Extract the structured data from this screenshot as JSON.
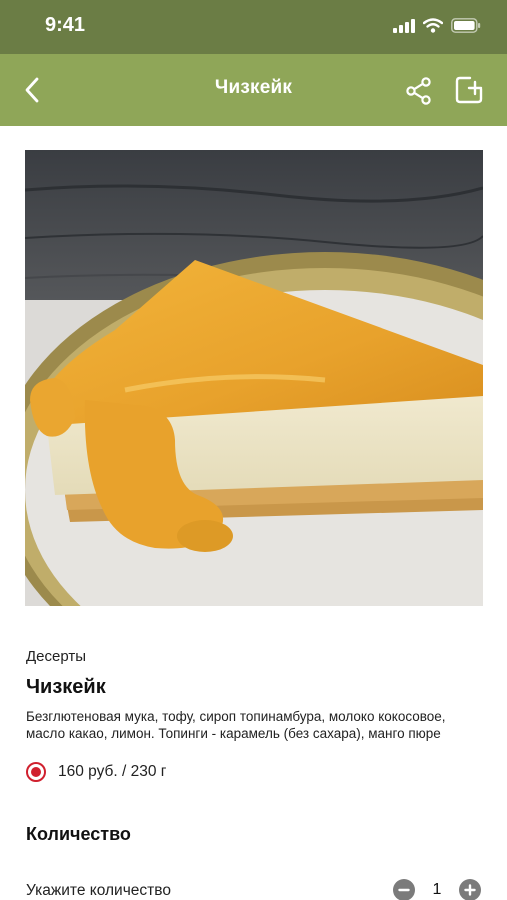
{
  "status_bar": {
    "time": "9:41"
  },
  "app_bar": {
    "title": "Чизкейк"
  },
  "product": {
    "category": "Десерты",
    "name": "Чизкейк",
    "ingredients": "Безглютеновая мука, тофу, сироп топинамбура, молоко кокосовое, масло какао, лимон. Топинги - карамель (без сахара), манго пюре",
    "price_option": "160 руб. / 230 г",
    "price_option_selected": true
  },
  "quantity": {
    "heading": "Количество",
    "label": "Укажите количество",
    "value": "1"
  },
  "colors": {
    "status_bar": "#6b7d45",
    "app_bar": "#8fa658",
    "radio_accent": "#d0202e"
  },
  "icons": {
    "back": "chevron-left-icon",
    "share": "share-icon",
    "add_to_collection": "add-box-icon",
    "decrement": "minus-circle-icon",
    "increment": "plus-circle-icon"
  }
}
